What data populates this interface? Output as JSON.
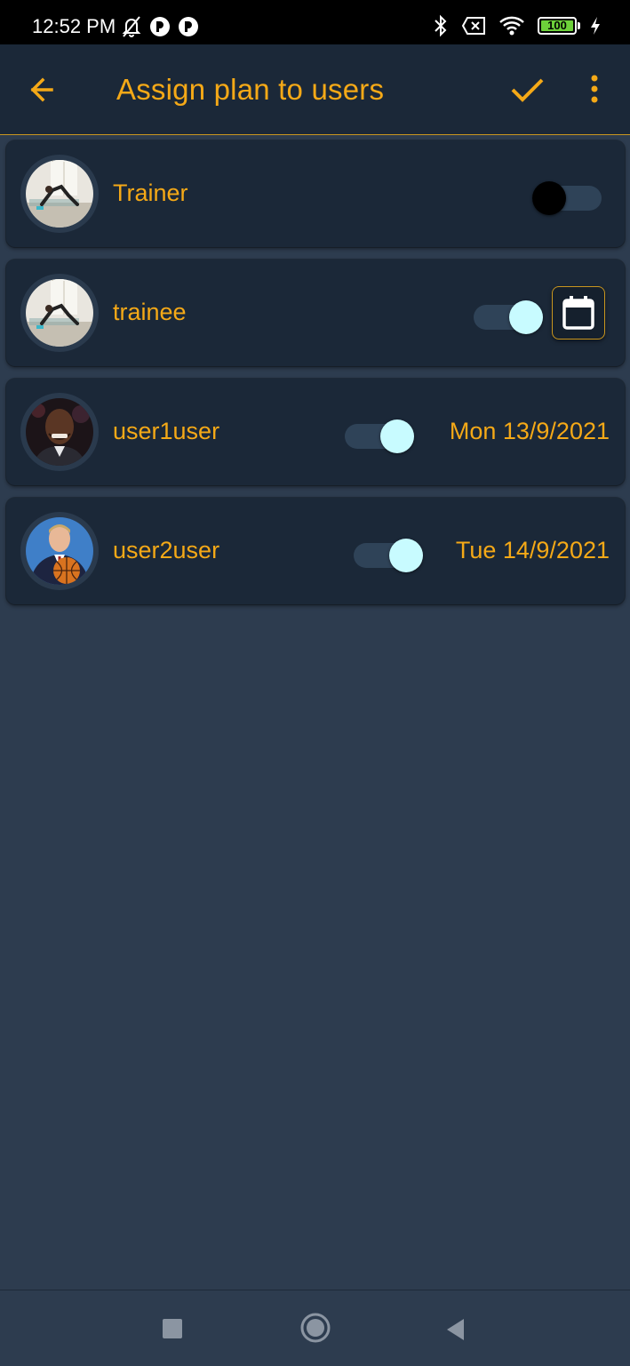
{
  "status_bar": {
    "time": "12:52 PM",
    "battery": "100",
    "icons": [
      "mute-bell-icon",
      "app-notification-icon",
      "app-notification-icon",
      "bluetooth-icon",
      "sim-blocked-icon",
      "wifi-icon",
      "battery-icon",
      "charging-icon"
    ]
  },
  "app_bar": {
    "title": "Assign plan to users",
    "back_icon": "arrow-left-icon",
    "confirm_icon": "check-icon",
    "more_icon": "more-vert-icon"
  },
  "users": [
    {
      "name": "Trainer",
      "toggle_on": false,
      "date": "",
      "show_calendar": false,
      "avatar": "workout-photo"
    },
    {
      "name": "trainee",
      "toggle_on": true,
      "date": "",
      "show_calendar": true,
      "avatar": "workout-photo"
    },
    {
      "name": "user1user",
      "toggle_on": true,
      "date": "Mon 13/9/2021",
      "show_calendar": false,
      "avatar": "portrait-photo"
    },
    {
      "name": "user2user",
      "toggle_on": true,
      "date": "Tue 14/9/2021",
      "show_calendar": false,
      "avatar": "basketball-portrait-photo"
    }
  ],
  "nav_bar": {
    "icons": [
      "recents-square-icon",
      "home-circle-icon",
      "back-triangle-icon"
    ]
  },
  "colors": {
    "accent": "#f5a917",
    "background": "#2d3c4f",
    "surface": "#1b2838",
    "toggle_thumb_on": "#c8fbff",
    "toggle_thumb_off": "#000000"
  }
}
